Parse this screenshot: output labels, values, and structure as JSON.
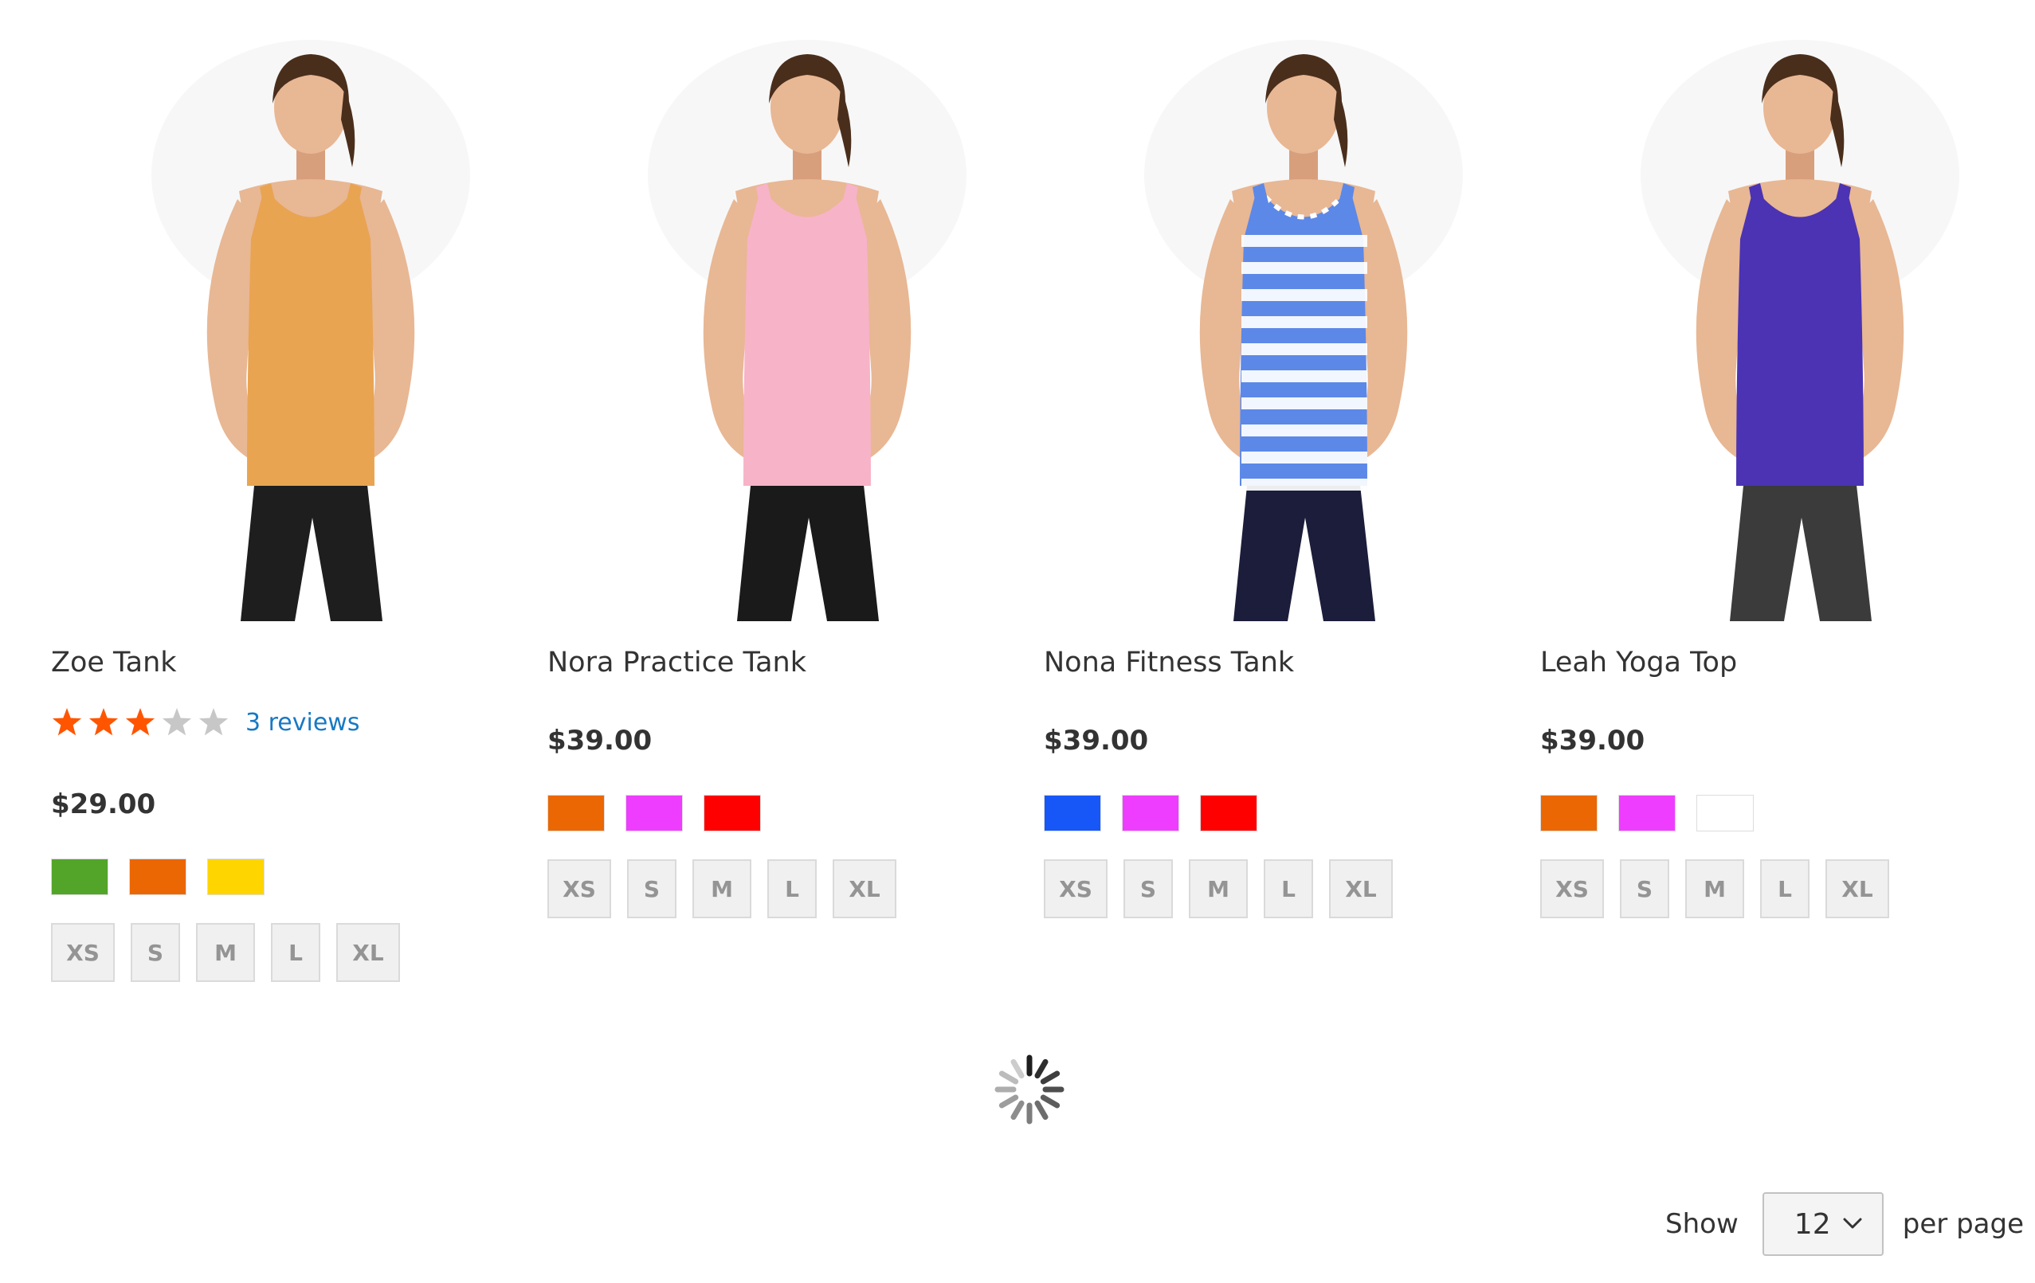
{
  "products": [
    {
      "name": "Zoe Tank",
      "rating_percent": 60,
      "reviews_label": "3 reviews",
      "price": "$29.00",
      "colors": [
        {
          "name": "Green",
          "hex": "#53a529"
        },
        {
          "name": "Orange",
          "hex": "#eb6703"
        },
        {
          "name": "Yellow",
          "hex": "#ffd500"
        }
      ],
      "sizes": [
        "XS",
        "S",
        "M",
        "L",
        "XL"
      ],
      "image": {
        "top_color": "#e9a452",
        "top_style": "plain",
        "bottom_color": "#1e1e1e"
      }
    },
    {
      "name": "Nora Practice Tank",
      "price": "$39.00",
      "colors": [
        {
          "name": "Orange",
          "hex": "#eb6703"
        },
        {
          "name": "Purple",
          "hex": "#ef3dff"
        },
        {
          "name": "Red",
          "hex": "#ff0000"
        }
      ],
      "sizes": [
        "XS",
        "S",
        "M",
        "L",
        "XL"
      ],
      "image": {
        "top_color": "#f7b3c8",
        "top_style": "plain",
        "bottom_color": "#1a1a1a"
      }
    },
    {
      "name": "Nona Fitness Tank",
      "price": "$39.00",
      "colors": [
        {
          "name": "Blue",
          "hex": "#1857f7"
        },
        {
          "name": "Purple",
          "hex": "#ef3dff"
        },
        {
          "name": "Red",
          "hex": "#ff0000"
        }
      ],
      "sizes": [
        "XS",
        "S",
        "M",
        "L",
        "XL"
      ],
      "image": {
        "top_color": "#5c88e8",
        "top_style": "stripes",
        "bottom_color": "#1b1d3a"
      }
    },
    {
      "name": "Leah Yoga Top",
      "price": "$39.00",
      "colors": [
        {
          "name": "Orange",
          "hex": "#eb6703"
        },
        {
          "name": "Purple",
          "hex": "#ef3dff"
        },
        {
          "name": "White",
          "hex": "#ffffff"
        }
      ],
      "sizes": [
        "XS",
        "S",
        "M",
        "L",
        "XL"
      ],
      "image": {
        "top_color": "#4b33b3",
        "top_style": "plain",
        "bottom_color": "#3b3b3b"
      }
    }
  ],
  "loader_icon": "spinner-icon",
  "toolbar": {
    "show_label": "Show",
    "limiter_value": "12",
    "per_page_label": "per page",
    "limiter_icon": "chevron-down-icon"
  },
  "colors": {
    "star_filled": "#ff5501",
    "star_empty": "#c7c7c7",
    "link": "#1979c3"
  }
}
